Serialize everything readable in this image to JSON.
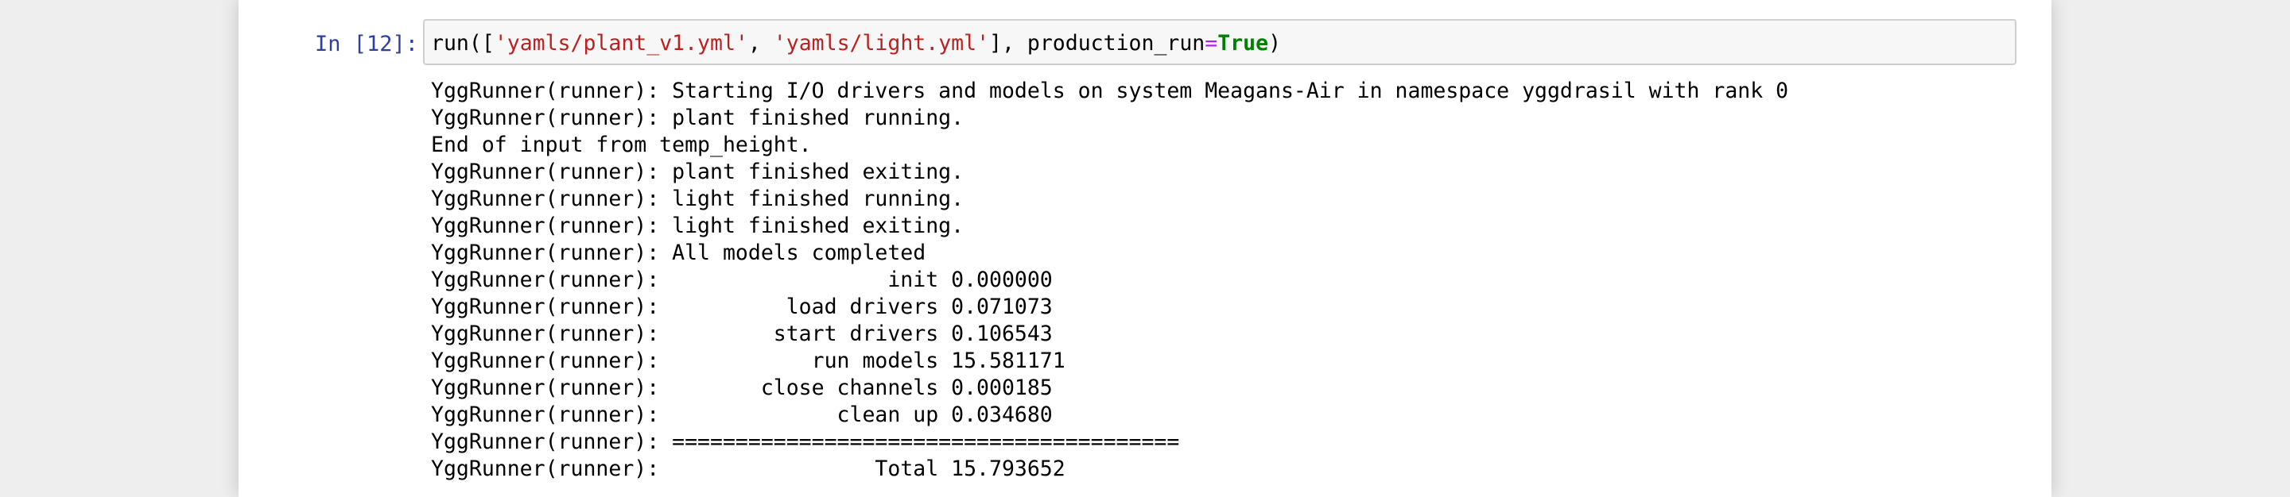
{
  "cell": {
    "prompt": "In [12]:",
    "code": {
      "t1": "run([",
      "t2": "'yamls/plant_v1.yml'",
      "t3": ", ",
      "t4": "'yamls/light.yml'",
      "t5": "], production_run",
      "t6": "=",
      "t7": "True",
      "t8": ")"
    },
    "output": [
      "YggRunner(runner): Starting I/O drivers and models on system Meagans-Air in namespace yggdrasil with rank 0",
      "YggRunner(runner): plant finished running.",
      "End of input from temp_height.",
      "YggRunner(runner): plant finished exiting.",
      "YggRunner(runner): light finished running.",
      "YggRunner(runner): light finished exiting.",
      "YggRunner(runner): All models completed",
      "YggRunner(runner):                  init 0.000000",
      "YggRunner(runner):          load drivers 0.071073",
      "YggRunner(runner):         start drivers 0.106543",
      "YggRunner(runner):            run models 15.581171",
      "YggRunner(runner):        close channels 0.000185",
      "YggRunner(runner):              clean up 0.034680",
      "YggRunner(runner): ========================================",
      "YggRunner(runner):                 Total 15.793652"
    ]
  }
}
